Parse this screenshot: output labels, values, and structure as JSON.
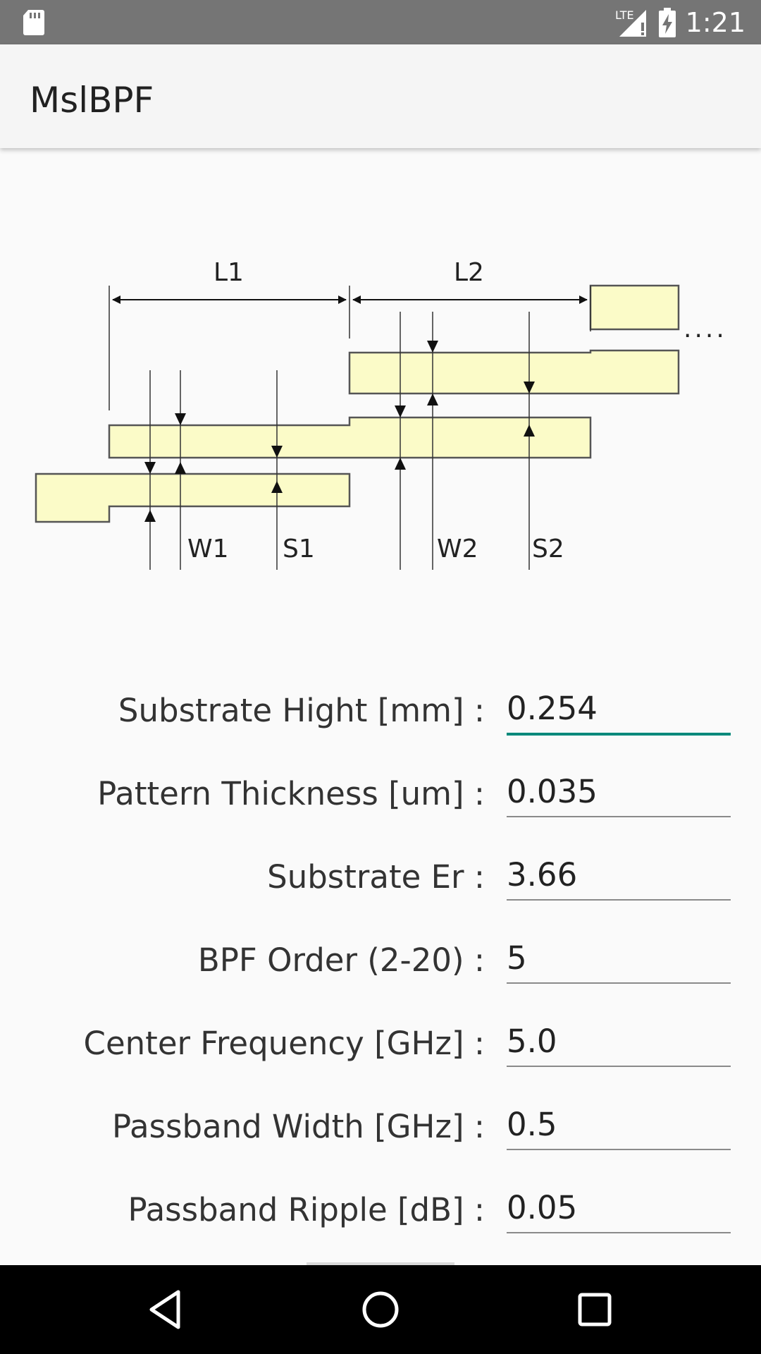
{
  "status_bar": {
    "time": "1:21",
    "network_label": "LTE",
    "icons": [
      "sd-card-icon",
      "signal-icon",
      "battery-charging-icon"
    ]
  },
  "app_bar": {
    "title": "MslBPF"
  },
  "diagram": {
    "labels": {
      "L1": "L1",
      "L2": "L2",
      "W1": "W1",
      "S1": "S1",
      "W2": "W2",
      "S2": "S2",
      "ellipsis": "...."
    },
    "colors": {
      "strip_fill": "#fbfbc8",
      "strip_stroke": "#555555"
    }
  },
  "form": {
    "fields": [
      {
        "label": "Substrate Hight [mm] :",
        "value": "0.254",
        "focused": true
      },
      {
        "label": "Pattern Thickness [um] :",
        "value": "0.035"
      },
      {
        "label": "Substrate Er :",
        "value": "3.66"
      },
      {
        "label": "BPF Order (2-20) :",
        "value": "5"
      },
      {
        "label": "Center Frequency [GHz] :",
        "value": "5.0"
      },
      {
        "label": "Passband Width [GHz] :",
        "value": "0.5"
      },
      {
        "label": "Passband Ripple [dB] :",
        "value": "0.05"
      }
    ]
  },
  "colors": {
    "accent": "#00897b",
    "status_bar": "#757575",
    "app_bar": "#f5f5f5",
    "nav_bar": "#000000"
  },
  "nav_bar": {
    "buttons": [
      "back-icon",
      "home-icon",
      "recents-icon"
    ]
  }
}
